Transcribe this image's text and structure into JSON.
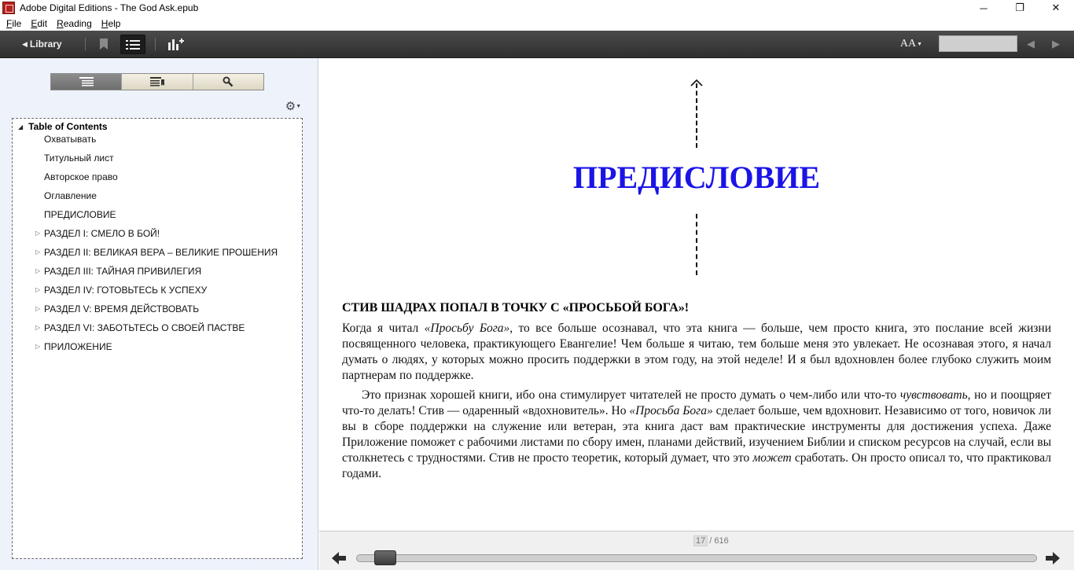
{
  "window": {
    "title": "Adobe Digital Editions - The God Ask.epub",
    "controls": {
      "minimize": "─",
      "restore": "❐",
      "close": "✕"
    }
  },
  "menu": [
    {
      "label": "File",
      "accel": "F",
      "rest": "ile"
    },
    {
      "label": "Edit",
      "accel": "E",
      "rest": "dit"
    },
    {
      "label": "Reading",
      "accel": "R",
      "rest": "eading"
    },
    {
      "label": "Help",
      "accel": "H",
      "rest": "elp"
    }
  ],
  "toolbar": {
    "library_label": "Library",
    "font_label": "AA",
    "search_value": ""
  },
  "sidebar": {
    "tabs": [
      "toc-tab",
      "bookmarks-tab",
      "search-tab"
    ],
    "active_tab": 0,
    "toc_root": "Table of Contents",
    "items": [
      {
        "label": "Охватывать",
        "expandable": false
      },
      {
        "label": "Титульный лист",
        "expandable": false
      },
      {
        "label": "Авторское право",
        "expandable": false
      },
      {
        "label": "Оглавление",
        "expandable": false
      },
      {
        "label": "ПРЕДИСЛОВИЕ",
        "expandable": false
      },
      {
        "label": "РАЗДЕЛ I: СМЕЛО В БОЙ!",
        "expandable": true
      },
      {
        "label": "РАЗДЕЛ II: ВЕЛИКАЯ ВЕРА – ВЕЛИКИЕ ПРОШЕНИЯ",
        "expandable": true
      },
      {
        "label": "РАЗДЕЛ III: ТАЙНАЯ ПРИВИЛЕГИЯ",
        "expandable": true
      },
      {
        "label": "РАЗДЕЛ IV: ГОТОВЬТЕСЬ К УСПЕХУ",
        "expandable": true
      },
      {
        "label": "РАЗДЕЛ V: ВРЕМЯ ДЕЙСТВОВАТЬ",
        "expandable": true
      },
      {
        "label": "РАЗДЕЛ VI: ЗАБОТЬТЕСЬ О СВОЕЙ ПАСТВЕ",
        "expandable": true
      },
      {
        "label": "ПРИЛОЖЕНИЕ",
        "expandable": true
      }
    ]
  },
  "reader": {
    "chapter_title": "ПРЕДИСЛОВИЕ",
    "chapter_title_color": "#1a14e6",
    "section_heading": "СТИВ ШАДРАХ ПОПАЛ В ТОЧКУ С «ПРОСЬБОЙ БОГА»!",
    "paragraph_1": [
      {
        "t": "Когда я читал "
      },
      {
        "t": "«Просьбу Бога»",
        "i": true
      },
      {
        "t": ", то все больше осознавал, что эта книга — больше, чем просто книга, это послание всей жизни посвященного человека, практикующего Евангелие! Чем больше я читаю, тем больше меня это увлекает. Не осознавая этого, я начал думать о людях, у которых можно просить поддержки в этом году, на этой неделе! И я был вдохновлен более глубоко служить моим партнерам по поддержке."
      }
    ],
    "paragraph_2": [
      {
        "t": "Это признак хорошей книги, ибо она стимулирует читателей не просто думать о чем-либо или что-то "
      },
      {
        "t": "чувствовать",
        "i": true
      },
      {
        "t": ", но и поощряет что-то делать! Стив — одаренный «вдохновитель». Но "
      },
      {
        "t": "«Просьба Бога»",
        "i": true
      },
      {
        "t": " сделает больше, чем вдохновит. Независимо от того, новичок ли вы в сборе поддержки на служение или ветеран, эта книга даст вам практические инструменты для достижения успеха. Даже Приложение поможет с рабочими листами по сбору имен, планами действий, изучением Библии и списком ресурсов на случай, если вы столкнетесь с трудностями. Стив не просто теоретик, который думает, что это "
      },
      {
        "t": "может",
        "i": true
      },
      {
        "t": " сработать. Он просто описал то, что практиковал годами."
      }
    ]
  },
  "pager": {
    "current": "17",
    "separator": "/ 616",
    "total": 616,
    "progress": 0.027
  }
}
